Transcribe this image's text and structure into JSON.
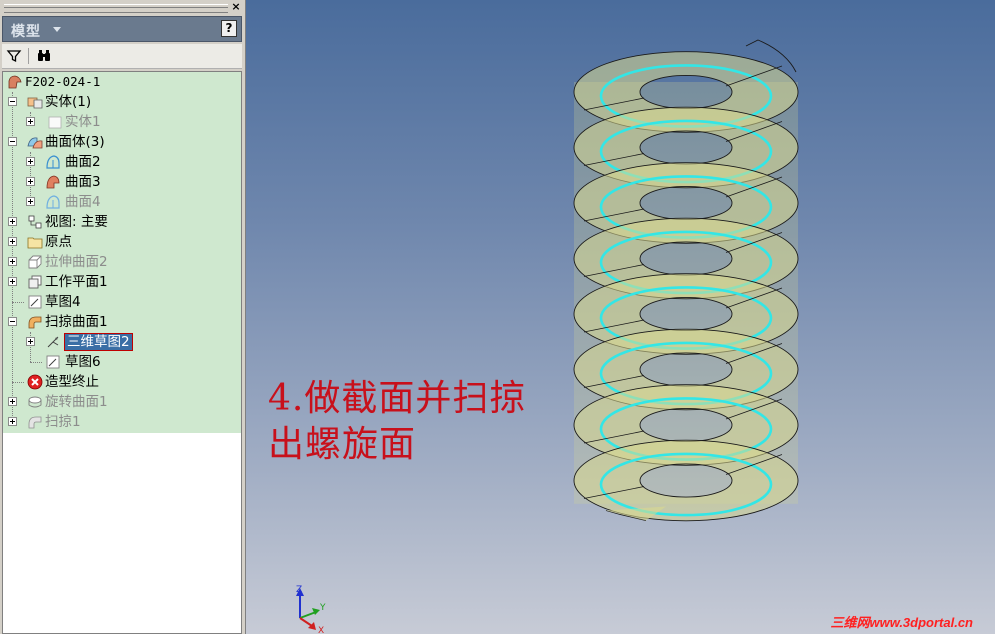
{
  "panel": {
    "title": "模型",
    "close_label": "×",
    "help_label": "?"
  },
  "toolbar": {
    "filter_icon": "filter-icon",
    "find_icon": "binoculars-icon"
  },
  "tree": {
    "root": "F202-024-1",
    "solid_group": "实体(1)",
    "solid1": "实体1",
    "surface_group": "曲面体(3)",
    "surface2": "曲面2",
    "surface3": "曲面3",
    "surface4": "曲面4",
    "view": "视图: 主要",
    "origin": "原点",
    "extrude_surface2": "拉伸曲面2",
    "work_plane1": "工作平面1",
    "sketch4": "草图4",
    "sweep_surface1": "扫掠曲面1",
    "sketch3d2": "三维草图2",
    "sketch6": "草图6",
    "end_of_part": "造型终止",
    "revolve_surface1": "旋转曲面1",
    "sweep1": "扫掠1"
  },
  "viewport": {
    "caption_line1": "4.做截面并扫掠",
    "caption_line2": "出螺旋面",
    "watermark": "三维网www.3dportal.cn",
    "axis_labels": {
      "z": "Z",
      "y": "Y",
      "x": "X"
    },
    "colors": {
      "helix": "#33e6e6",
      "surface": "#d8d890",
      "caption": "#c8101b",
      "watermark": "#ff2020"
    }
  }
}
